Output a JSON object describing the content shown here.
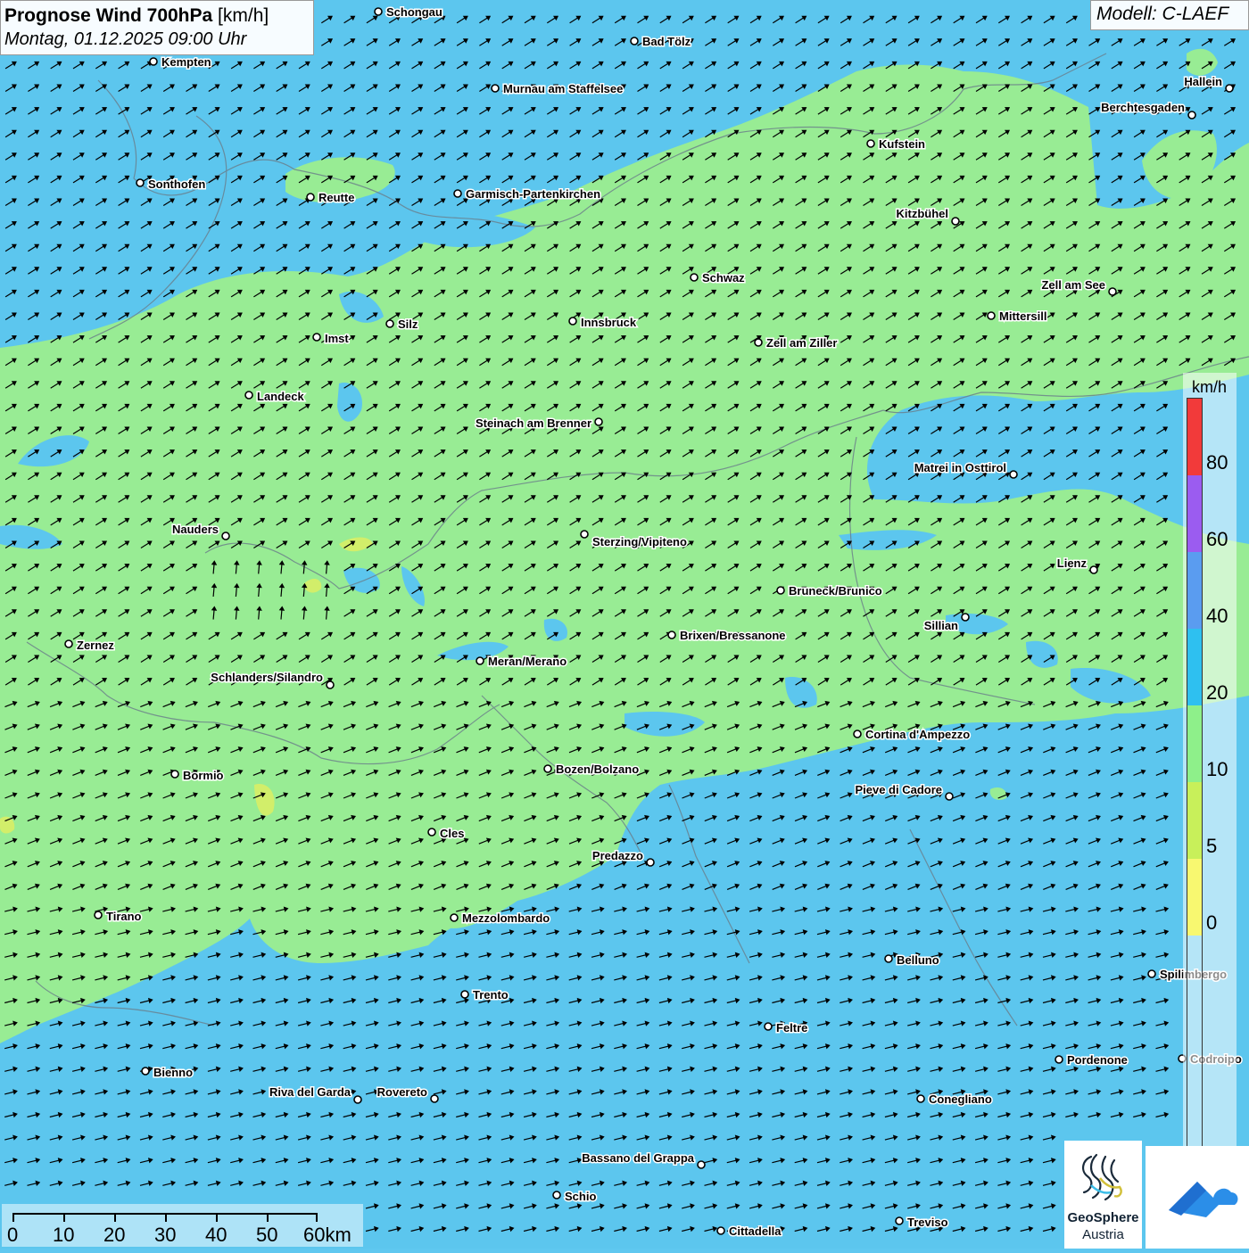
{
  "title": {
    "main": "Prognose Wind 700hPa",
    "unit": "[km/h]",
    "date": "Montag, 01.12.2025 09:00 Uhr"
  },
  "model": "Modell: C-LAEF",
  "legend": {
    "unit": "km/h",
    "labels": [
      "80",
      "60",
      "40",
      "20",
      "10",
      "5",
      "0"
    ],
    "colors": [
      "#f23a3a",
      "#9b5cf0",
      "#5a9cf0",
      "#2ec0f0",
      "#8ef08a",
      "#c8f05a",
      "#f8f870"
    ]
  },
  "scale": {
    "labels": [
      "0",
      "10",
      "20",
      "30",
      "40",
      "50",
      "60km"
    ]
  },
  "logo": {
    "line1": "GeoSphere",
    "line2": "Austria"
  },
  "cities": [
    {
      "name": "Schongau"
    },
    {
      "name": "Bad Tölz"
    },
    {
      "name": "Kempten"
    },
    {
      "name": "Murnau am Staffelsee"
    },
    {
      "name": "Hallein"
    },
    {
      "name": "Berchtesgaden"
    },
    {
      "name": "Kufstein"
    },
    {
      "name": "Sonthofen"
    },
    {
      "name": "Reutte"
    },
    {
      "name": "Garmisch-Partenkirchen"
    },
    {
      "name": "Kitzbühel"
    },
    {
      "name": "Schwaz"
    },
    {
      "name": "Zell am See"
    },
    {
      "name": "Innsbruck"
    },
    {
      "name": "Mittersill"
    },
    {
      "name": "Silz"
    },
    {
      "name": "Imst"
    },
    {
      "name": "Zell am Ziller"
    },
    {
      "name": "Landeck"
    },
    {
      "name": "Steinach am Brenner"
    },
    {
      "name": "Matrei in Osttirol"
    },
    {
      "name": "Nauders"
    },
    {
      "name": "Sterzing/Vipiteno"
    },
    {
      "name": "Lienz"
    },
    {
      "name": "Bruneck/Brunico"
    },
    {
      "name": "Sillian"
    },
    {
      "name": "Zernez"
    },
    {
      "name": "Brixen/Bressanone"
    },
    {
      "name": "Meran/Merano"
    },
    {
      "name": "Schlanders/Silandro"
    },
    {
      "name": "Cortina d'Ampezzo"
    },
    {
      "name": "Bozen/Bolzano"
    },
    {
      "name": "Bormio"
    },
    {
      "name": "Pieve di Cadore"
    },
    {
      "name": "Cles"
    },
    {
      "name": "Predazzo"
    },
    {
      "name": "Tirano"
    },
    {
      "name": "Mezzolombardo"
    },
    {
      "name": "Belluno"
    },
    {
      "name": "Spilimbergo"
    },
    {
      "name": "Trento"
    },
    {
      "name": "Feltre"
    },
    {
      "name": "Pordenone"
    },
    {
      "name": "Codroipo"
    },
    {
      "name": "Bienno"
    },
    {
      "name": "Riva del Garda"
    },
    {
      "name": "Rovereto"
    },
    {
      "name": "Conegliano"
    },
    {
      "name": "Bassano del Grappa"
    },
    {
      "name": "Schio"
    },
    {
      "name": "Treviso"
    },
    {
      "name": "Cittadella"
    }
  ]
}
